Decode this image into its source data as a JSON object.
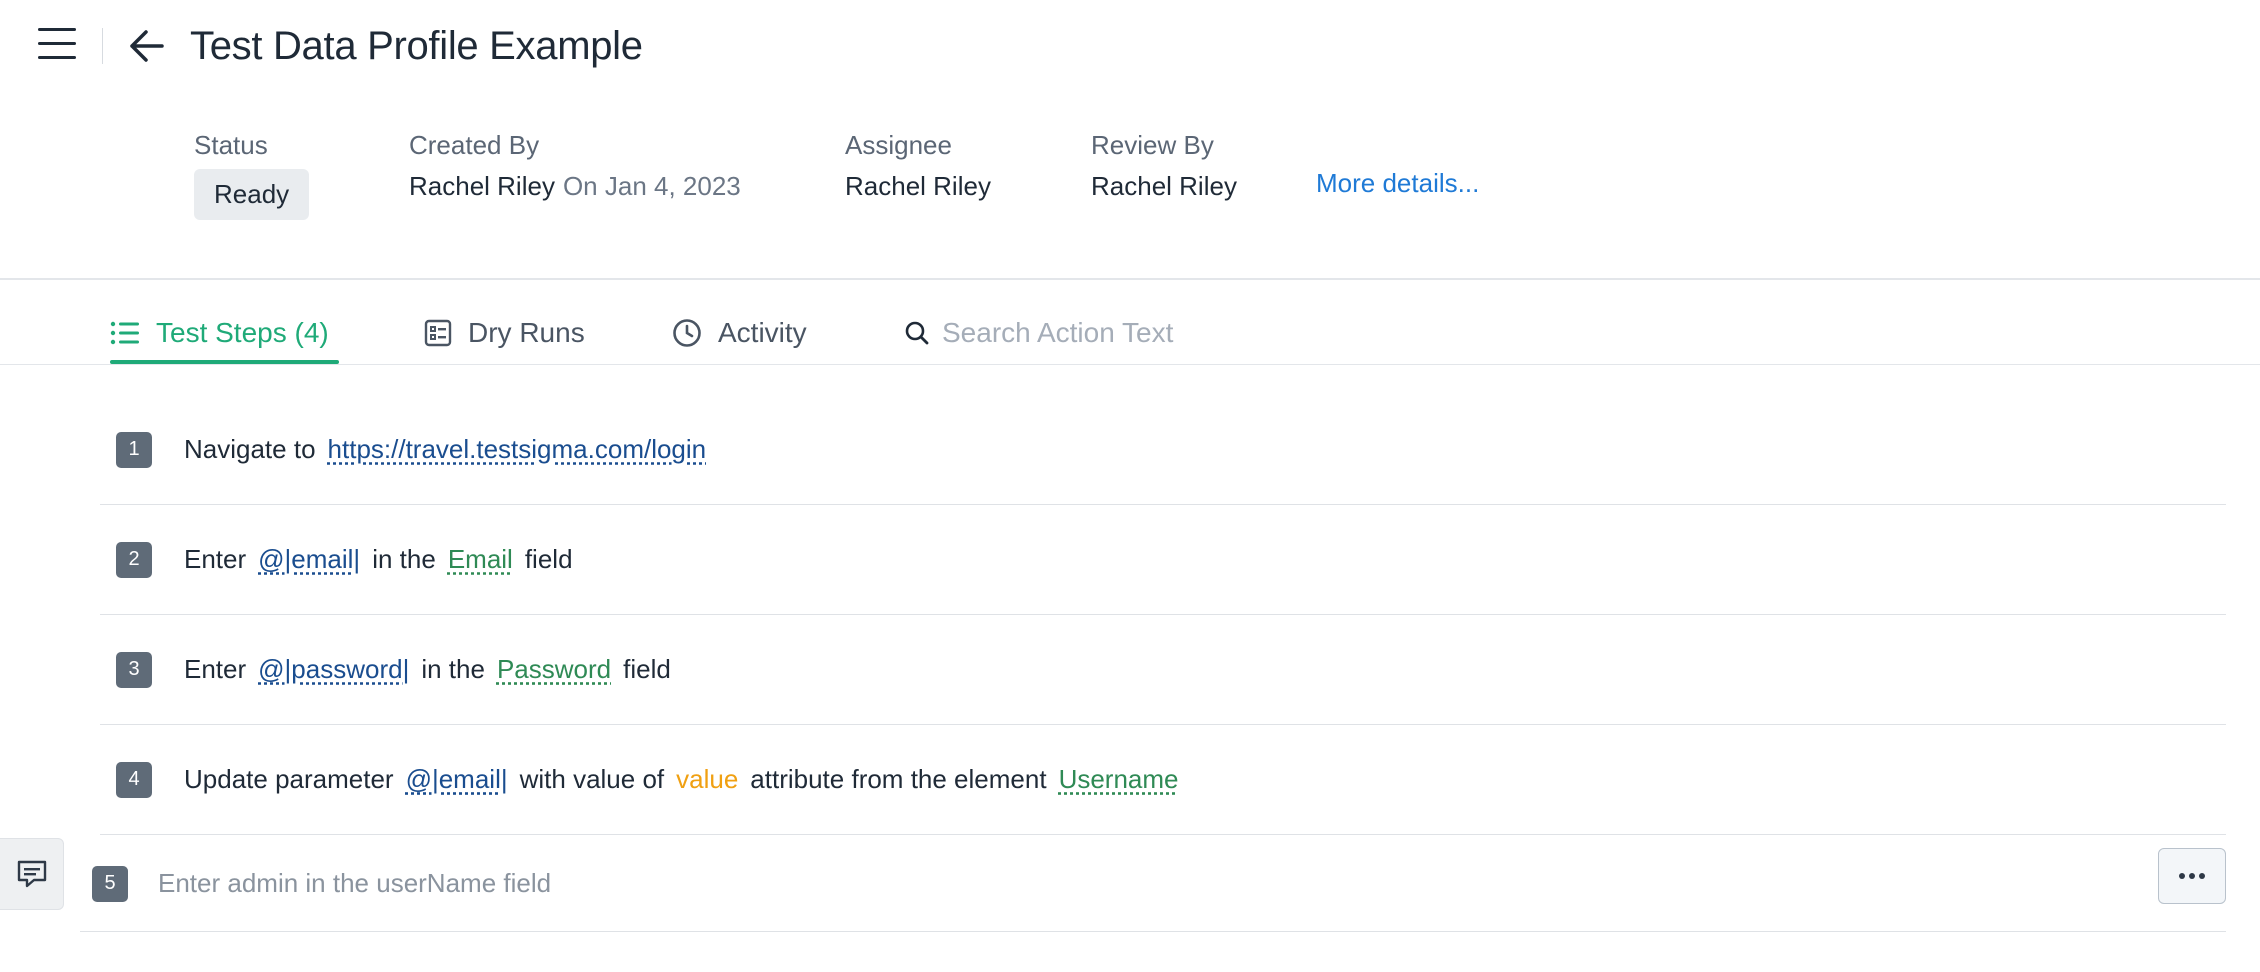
{
  "header": {
    "title": "Test Data Profile Example"
  },
  "meta": {
    "status": {
      "label": "Status",
      "value": "Ready"
    },
    "created_by": {
      "label": "Created By",
      "value": "Rachel Riley",
      "date": "On Jan 4, 2023"
    },
    "assignee": {
      "label": "Assignee",
      "value": "Rachel Riley"
    },
    "review_by": {
      "label": "Review By",
      "value": "Rachel Riley"
    },
    "more_details": "More details..."
  },
  "tabs": {
    "test_steps": "Test Steps (4)",
    "dry_runs": "Dry Runs",
    "activity": "Activity",
    "active": "test_steps"
  },
  "search": {
    "placeholder": "Search Action Text",
    "value": ""
  },
  "steps": [
    {
      "number": "1",
      "parts": {
        "p1": "Navigate to",
        "url": "https://travel.testsigma.com/login"
      }
    },
    {
      "number": "2",
      "parts": {
        "p1": "Enter",
        "param": "@|email|",
        "p2": "in the",
        "element": "Email",
        "p3": "field"
      }
    },
    {
      "number": "3",
      "parts": {
        "p1": "Enter",
        "param": "@|password|",
        "p2": "in the",
        "element": "Password",
        "p3": "field"
      }
    },
    {
      "number": "4",
      "parts": {
        "p1": "Update parameter",
        "param": "@|email|",
        "p2": "with value of",
        "attribute": "value",
        "p3": "attribute from the element",
        "element": "Username"
      }
    }
  ],
  "new_step": {
    "number": "5",
    "placeholder": "Enter admin in the userName field",
    "value": ""
  },
  "colors": {
    "accent": "#1faa78",
    "link": "#1f7ad6",
    "param": "#1a4d8f",
    "element": "#2f8a55",
    "attribute": "#f0a012"
  },
  "icons": {
    "menu": "hamburger-icon",
    "back": "arrow-left-icon",
    "test_steps": "list-icon",
    "dry_runs": "checklist-icon",
    "activity": "clock-icon",
    "search": "search-icon",
    "feedback": "chat-icon",
    "more": "ellipsis-icon"
  }
}
